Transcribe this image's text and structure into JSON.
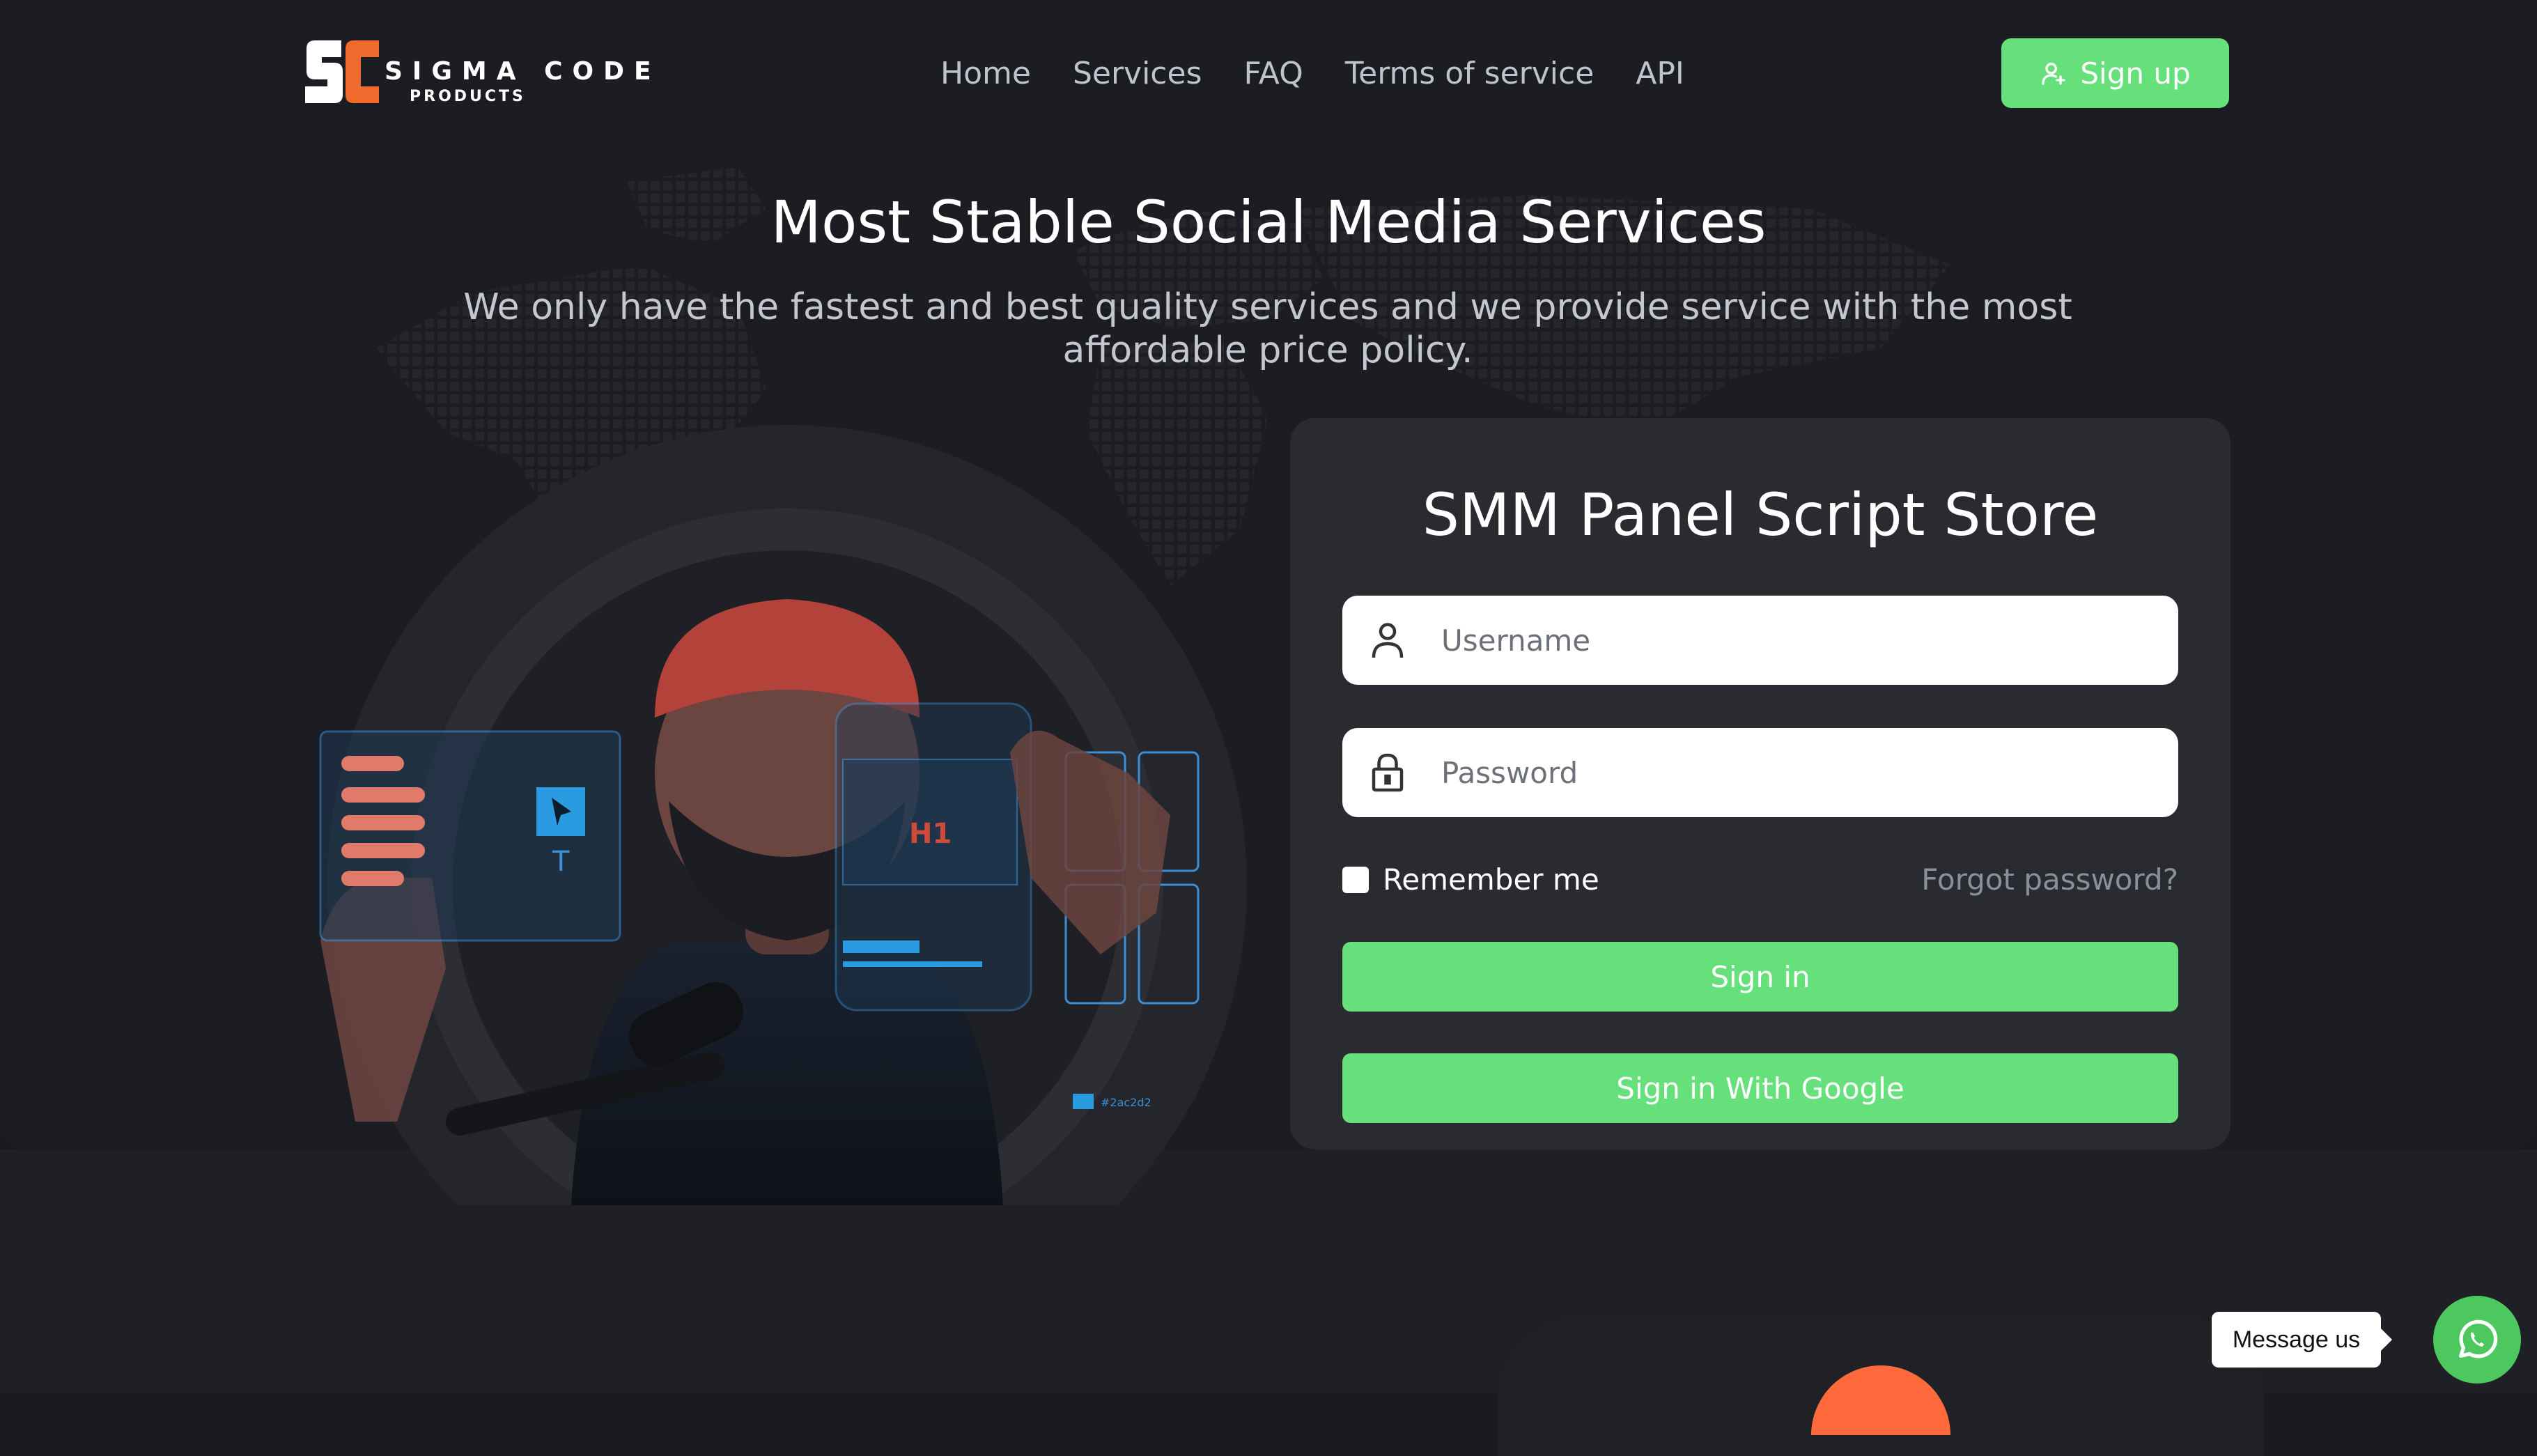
{
  "brand": {
    "logo_mark": "SC",
    "name_line1": "SIGMA CODE",
    "name_line2": "PRODUCTS",
    "accent_color": "#66e07a",
    "logo_orange": "#ef6a2c"
  },
  "nav": {
    "items": [
      {
        "label": "Home"
      },
      {
        "label": "Services"
      },
      {
        "label": "FAQ"
      },
      {
        "label": "Terms of service"
      },
      {
        "label": "API"
      }
    ],
    "signup_label": "Sign up",
    "signup_icon": "user-plus-icon"
  },
  "hero": {
    "title": "Most Stable Social Media Services",
    "subtitle": "We only have the fastest and best quality services and we provide service with the most affordable price policy."
  },
  "illustration": {
    "h1_label": "H1",
    "hex_label": "#2ac2d2"
  },
  "login": {
    "title": "SMM Panel Script Store",
    "username_placeholder": "Username",
    "password_placeholder": "Password",
    "remember_label": "Remember me",
    "forgot_label": "Forgot password?",
    "signin_label": "Sign in",
    "google_label": "Sign in With Google"
  },
  "chat": {
    "message_label": "Message us",
    "icon": "whatsapp-icon",
    "color": "#4cc85f"
  }
}
